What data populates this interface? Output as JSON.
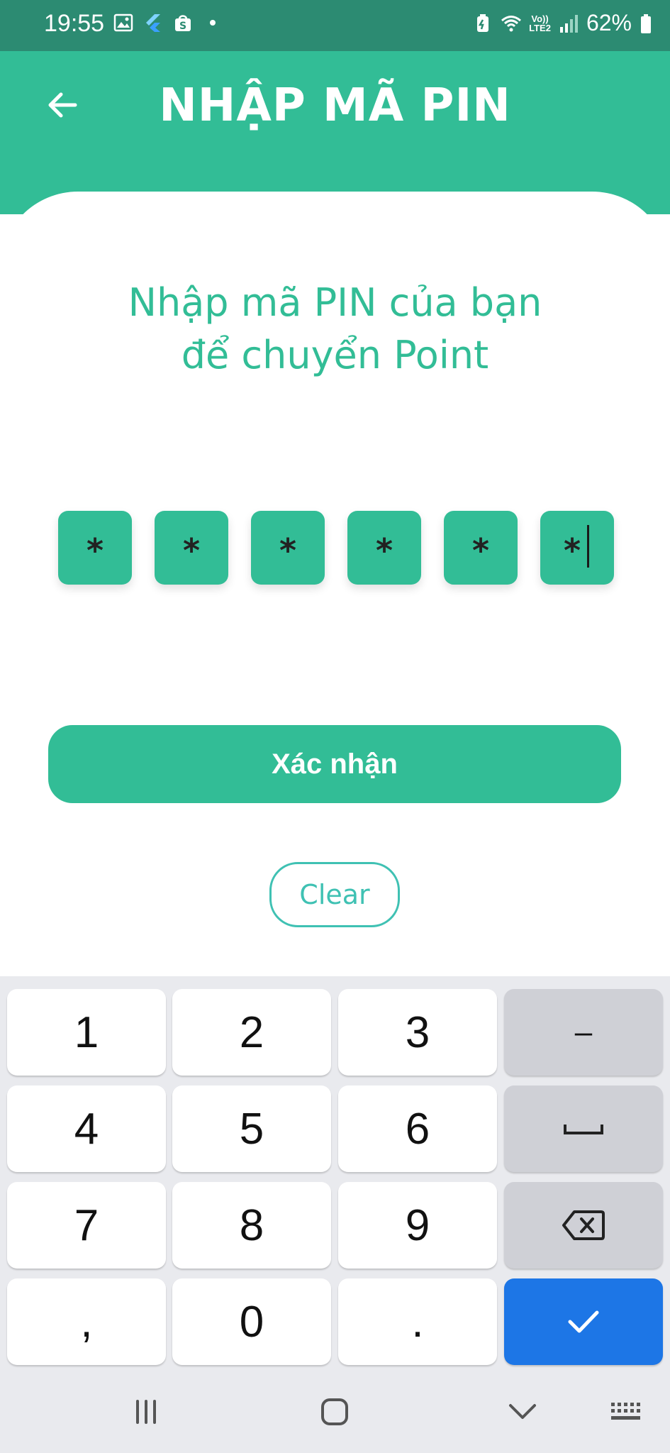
{
  "status_bar": {
    "time": "19:55",
    "battery": "62%",
    "network_label_top": "Vo))",
    "network_label_bottom": "LTE2",
    "icons_left": [
      "gallery-icon",
      "flutter-icon",
      "shopee-icon"
    ],
    "icons_right": [
      "battery-saver-icon",
      "wifi-icon",
      "signal-icon",
      "battery-icon"
    ]
  },
  "header": {
    "title": "NHẬP MÃ PIN",
    "back_icon": "arrow-left-icon"
  },
  "main": {
    "prompt": "Nhập mã PIN của bạn để chuyển Point",
    "pin": {
      "mask_char": "*",
      "length": 6,
      "filled": 6,
      "digits": [
        "*",
        "*",
        "*",
        "*",
        "*",
        "*"
      ]
    },
    "confirm_label": "Xác nhận",
    "clear_label": "Clear"
  },
  "keyboard": {
    "rows": [
      [
        "1",
        "2",
        "3",
        "–"
      ],
      [
        "4",
        "5",
        "6",
        "space"
      ],
      [
        "7",
        "8",
        "9",
        "backspace"
      ],
      [
        ",",
        "0",
        ".",
        "done"
      ]
    ],
    "labels": {
      "k1": "1",
      "k2": "2",
      "k3": "3",
      "minus": "–",
      "k4": "4",
      "k5": "5",
      "k6": "6",
      "k7": "7",
      "k8": "8",
      "k9": "9",
      "comma": ",",
      "k0": "0",
      "period": "."
    },
    "accent_color": "#1d76e6"
  },
  "nav_bar": {
    "items": [
      "recent-apps-icon",
      "home-icon",
      "back-chevron-icon",
      "keyboard-switch-icon"
    ]
  },
  "colors": {
    "primary": "#32bd96",
    "status_bar": "#2c8b72",
    "clear_outline": "#3fc1b3"
  }
}
